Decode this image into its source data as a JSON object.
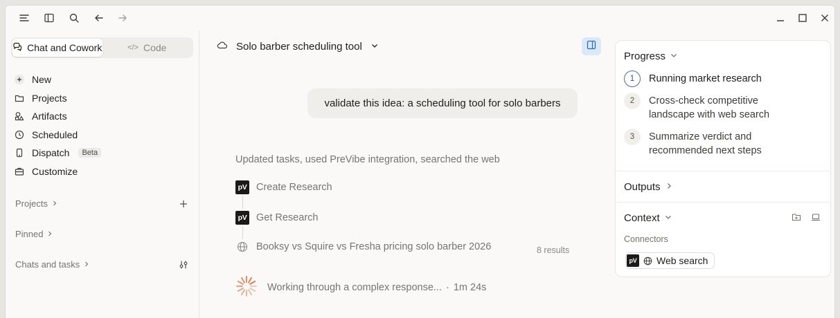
{
  "sidebar": {
    "tabs": [
      {
        "label": "Chat and Cowork",
        "icon": "chat-icon",
        "active": true
      },
      {
        "label": "Code",
        "icon": "code-icon",
        "active": false
      }
    ],
    "nav": [
      {
        "label": "New",
        "icon": "plus-circle-icon"
      },
      {
        "label": "Projects",
        "icon": "folder-icon"
      },
      {
        "label": "Artifacts",
        "icon": "shapes-icon"
      },
      {
        "label": "Scheduled",
        "icon": "clock-icon"
      },
      {
        "label": "Dispatch",
        "icon": "phone-icon",
        "badge": "Beta"
      },
      {
        "label": "Customize",
        "icon": "briefcase-icon"
      }
    ],
    "sections": [
      {
        "label": "Projects",
        "action_icon": "plus-icon"
      },
      {
        "label": "Pinned"
      },
      {
        "label": "Chats and tasks",
        "action_icon": "filter-icon"
      }
    ]
  },
  "main": {
    "title": "Solo barber scheduling tool",
    "user_message": "validate this idea: a scheduling tool for solo barbers",
    "summary": "Updated tasks, used PreVibe integration, searched the web",
    "steps": [
      {
        "icon_text": "pV",
        "label": "Create Research"
      },
      {
        "icon_text": "pV",
        "label": "Get Research"
      }
    ],
    "search": {
      "query": "Booksy vs Squire vs Fresha pricing solo barber 2026",
      "results": "8 results"
    },
    "status": {
      "text": "Working through a complex response...",
      "separator": "·",
      "elapsed": "1m 24s"
    }
  },
  "panel": {
    "progress": {
      "title": "Progress",
      "steps": [
        {
          "num": "1",
          "line1": "Running market research",
          "line2": "",
          "active": true
        },
        {
          "num": "2",
          "line1": "Cross-check competitive",
          "line2": "landscape with web search",
          "active": false
        },
        {
          "num": "3",
          "line1": "Summarize verdict and",
          "line2": "recommended next steps",
          "active": false
        }
      ]
    },
    "outputs": {
      "title": "Outputs"
    },
    "context": {
      "title": "Context",
      "connectors_label": "Connectors",
      "connector_icon_text": "pV",
      "chip_label": "Web search"
    }
  },
  "colors": {
    "accent_blue": "#2c6bc4",
    "toggle_bg": "#dbe8f8",
    "spinner": "#d9774b"
  }
}
